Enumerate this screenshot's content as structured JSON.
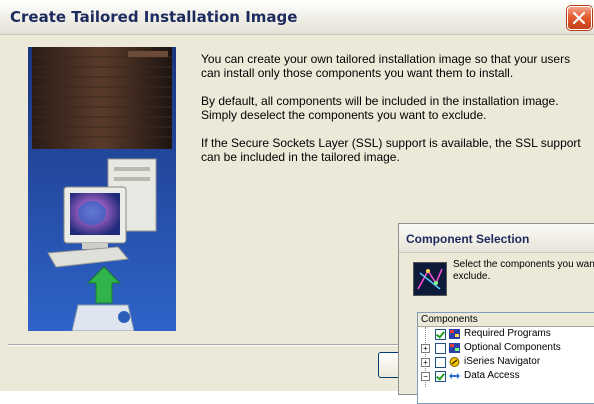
{
  "window": {
    "title": "Create Tailored Installation Image"
  },
  "body": {
    "paragraphs": [
      "You can create your own tailored installation image so that your users can install only those components you want them to install.",
      "By default, all components will be included in the installation image.  Simply deselect the components you want to exclude.",
      "If the Secure Sockets Layer (SSL) support is available, the SSL support can be included in the tailored image."
    ]
  },
  "dialog": {
    "title": "Component Selection",
    "instruction_line1": "Select the components you want",
    "instruction_line2": "exclude.",
    "tree_header": "Components",
    "items": [
      {
        "label": "Required Programs",
        "checked": true,
        "expander": "",
        "icon": "required-programs-icon"
      },
      {
        "label": "Optional Components",
        "checked": false,
        "expander": "+",
        "icon": "optional-components-icon"
      },
      {
        "label": "iSeries Navigator",
        "checked": false,
        "expander": "+",
        "icon": "iseries-navigator-icon"
      },
      {
        "label": "Data Access",
        "checked": true,
        "expander": "−",
        "icon": "data-access-icon"
      }
    ]
  }
}
